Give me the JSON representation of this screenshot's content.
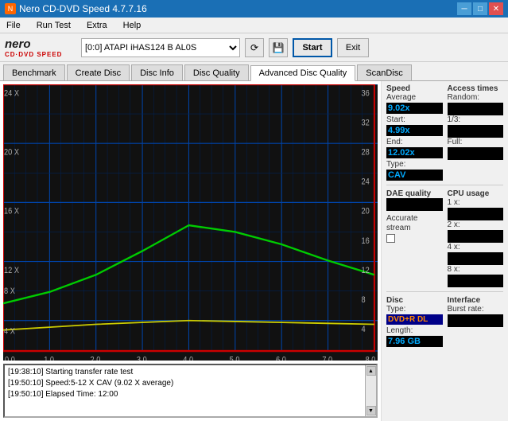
{
  "app": {
    "title": "Nero CD-DVD Speed 4.7.7.16",
    "icon": "●"
  },
  "title_controls": {
    "minimize": "─",
    "maximize": "□",
    "close": "✕"
  },
  "menu": {
    "items": [
      "File",
      "Run Test",
      "Extra",
      "Help"
    ]
  },
  "toolbar": {
    "drive_value": "[0:0]  ATAPI iHAS124  B AL0S",
    "start_label": "Start",
    "exit_label": "Exit"
  },
  "tabs": {
    "items": [
      "Benchmark",
      "Create Disc",
      "Disc Info",
      "Disc Quality",
      "Advanced Disc Quality",
      "ScanDisc"
    ],
    "active": "Advanced Disc Quality"
  },
  "chart": {
    "x_labels": [
      "0.0",
      "1.0",
      "2.0",
      "3.0",
      "4.0",
      "5.0",
      "6.0",
      "7.0",
      "8.0"
    ],
    "y_left_labels": [
      "24 X",
      "20 X",
      "16 X",
      "12 X",
      "8 X",
      "4 X"
    ],
    "y_right_labels": [
      "36",
      "32",
      "28",
      "24",
      "20",
      "16",
      "12",
      "8",
      "4"
    ]
  },
  "speed_panel": {
    "title": "Speed",
    "average_label": "Average",
    "average_value": "9.02x",
    "start_label": "Start:",
    "start_value": "4.99x",
    "end_label": "End:",
    "end_value": "12.02x",
    "type_label": "Type:",
    "type_value": "CAV"
  },
  "access_panel": {
    "title": "Access times",
    "random_label": "Random:",
    "third_label": "1/3:",
    "full_label": "Full:"
  },
  "cpu_panel": {
    "title": "CPU usage",
    "1x_label": "1 x:",
    "2x_label": "2 x:",
    "4x_label": "4 x:",
    "8x_label": "8 x:"
  },
  "dae_panel": {
    "title": "DAE quality"
  },
  "accurate_panel": {
    "title": "Accurate",
    "stream_label": "stream"
  },
  "disc_panel": {
    "title": "Disc",
    "type_label": "Type:",
    "type_value": "DVD+R DL",
    "length_label": "Length:",
    "length_value": "7.96 GB"
  },
  "interface_panel": {
    "title": "Interface",
    "burst_label": "Burst rate:"
  },
  "log": {
    "lines": [
      "[19:38:10]  Starting transfer rate test",
      "[19:50:10]  Speed:5-12 X CAV (9.02 X average)",
      "[19:50:10]  Elapsed Time: 12:00"
    ]
  }
}
